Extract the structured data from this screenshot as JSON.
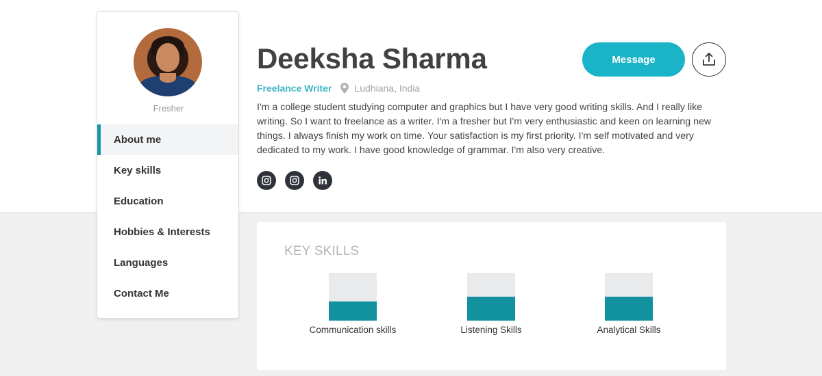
{
  "profile": {
    "name": "Deeksha Sharma",
    "role": "Freelance Writer",
    "location": "Ludhiana, India",
    "status": "Fresher",
    "bio": "I'm a college student studying computer and graphics but I have very good writing skills. And I really like writing. So I want to freelance as a writer. I'm a fresher but I'm very enthusiastic and keen on learning new things. I always finish my work on time. Your satisfaction is my first priority. I'm self motivated and very dedicated to my work. I have good knowledge of grammar. I'm also very creative."
  },
  "actions": {
    "message_label": "Message",
    "share_icon": "share-upload-icon"
  },
  "socials": [
    {
      "icon": "instagram-icon"
    },
    {
      "icon": "instagram-icon"
    },
    {
      "icon": "linkedin-icon"
    }
  ],
  "menu": {
    "items": [
      {
        "label": "About me",
        "active": true
      },
      {
        "label": "Key skills"
      },
      {
        "label": "Education"
      },
      {
        "label": "Hobbies & Interests"
      },
      {
        "label": "Languages"
      },
      {
        "label": "Contact Me"
      }
    ]
  },
  "skills": {
    "title": "KEY SKILLS",
    "items": [
      {
        "label": "Communication skills",
        "level": 0.4
      },
      {
        "label": "Listening Skills",
        "level": 0.5
      },
      {
        "label": "Analytical Skills",
        "level": 0.5
      }
    ]
  },
  "colors": {
    "accent": "#1bb3c8",
    "skill_fill": "#12919f",
    "role_text": "#3fb5c4",
    "dark": "#2f3339"
  }
}
